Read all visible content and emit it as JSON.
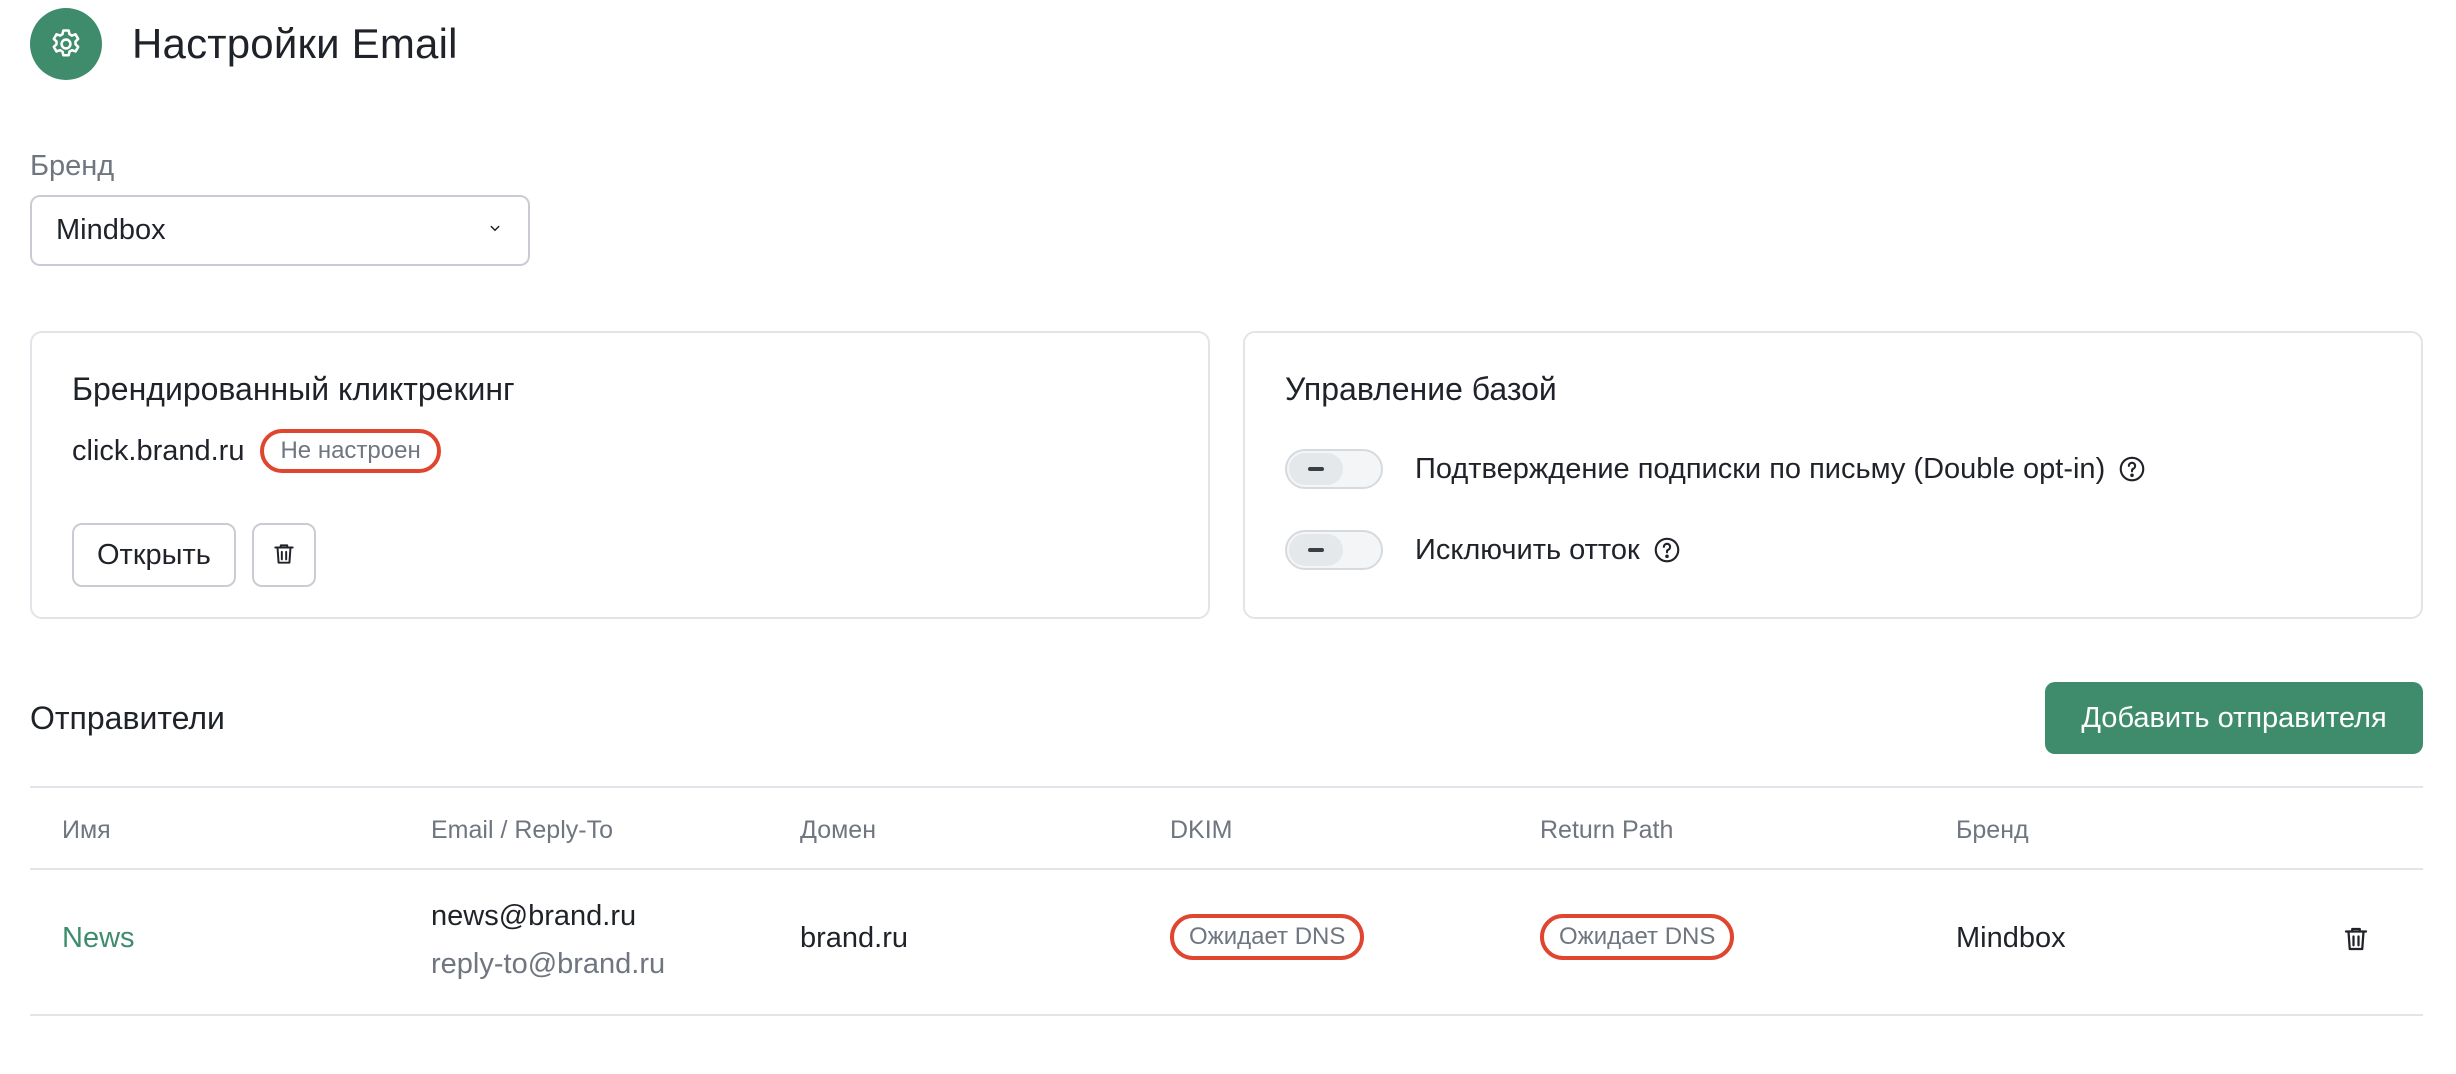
{
  "header": {
    "title": "Настройки Email",
    "icon": "gear-icon"
  },
  "brand": {
    "label": "Бренд",
    "selected": "Mindbox"
  },
  "click_tracking": {
    "title": "Брендированный кликтрекинг",
    "domain": "click.brand.ru",
    "status": "Не настроен",
    "open_button": "Открыть"
  },
  "base_management": {
    "title": "Управление базой",
    "toggles": [
      {
        "label": "Подтверждение подписки по письму (Double opt-in)",
        "state": "indeterminate"
      },
      {
        "label": "Исключить отток",
        "state": "indeterminate"
      }
    ]
  },
  "senders": {
    "title": "Отправители",
    "add_button": "Добавить отправителя",
    "columns": [
      "Имя",
      "Email / Reply-To",
      "Домен",
      "DKIM",
      "Return Path",
      "Бренд"
    ],
    "rows": [
      {
        "name": "News",
        "email": "news@brand.ru",
        "reply_to": "reply-to@brand.ru",
        "domain": "brand.ru",
        "dkim": "Ожидает DNS",
        "return_path": "Ожидает DNS",
        "brand": "Mindbox"
      }
    ]
  },
  "colors": {
    "accent": "#3f8c6c",
    "status_outline": "#e0452f"
  }
}
